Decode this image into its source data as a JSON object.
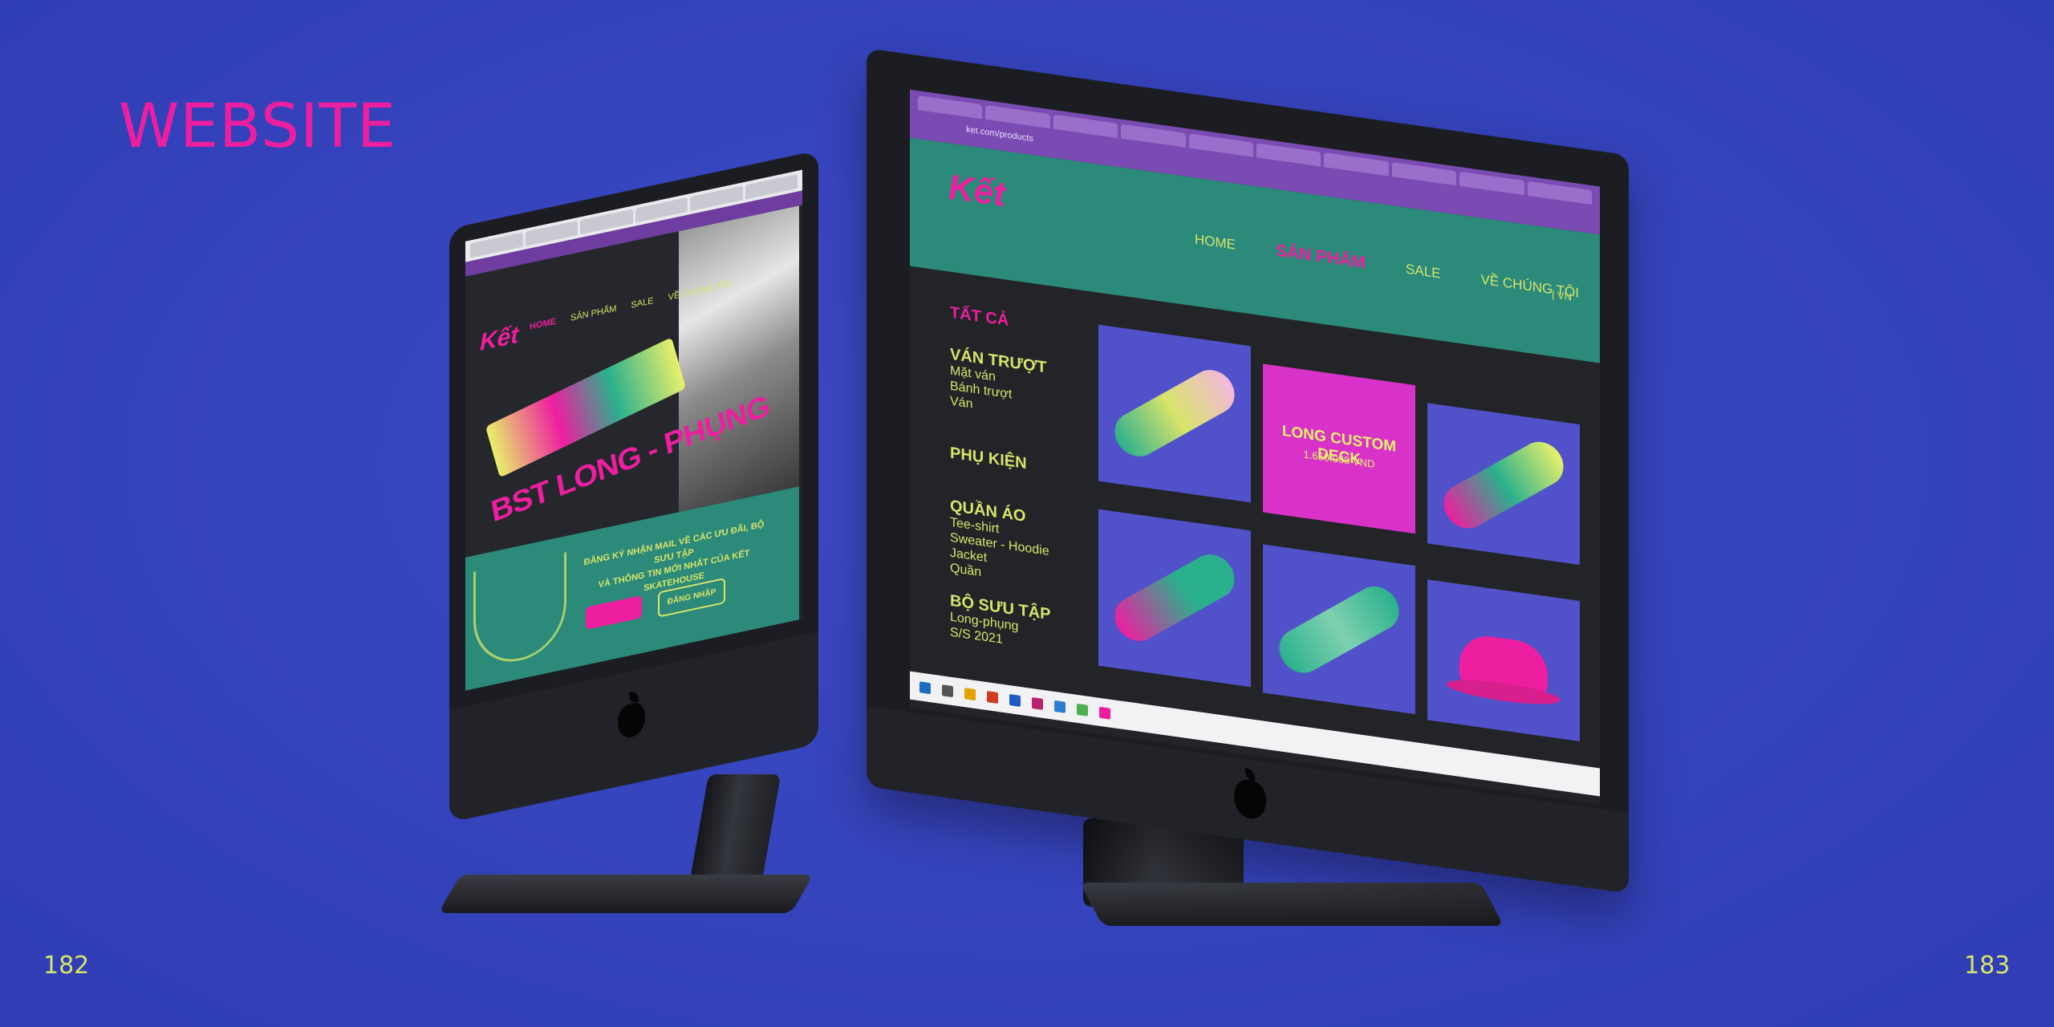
{
  "page": {
    "title": "WEBSITE",
    "page_left": "182",
    "page_right": "183"
  },
  "left_screen": {
    "nav": [
      "HOME",
      "SẢN PHẨM",
      "SALE",
      "VỀ CHÚNG TÔI"
    ],
    "headline": "BST LONG - PHỤNG",
    "cta_line1": "ĐĂNG KÝ NHẬN MAIL VỀ CÁC ƯU ĐÃI, BỘ SƯU TẬP",
    "cta_line2": "VÀ THÔNG TIN MỚI NHẤT CỦA KẾT SKATEHOUSE",
    "button_secondary": "ĐĂNG NHẬP"
  },
  "right_screen": {
    "url": "ket.com/products",
    "nav": {
      "home": "HOME",
      "products": "SẢN PHẨM",
      "sale": "SALE",
      "about": "VỀ CHÚNG TÔI",
      "lang": "| VN"
    },
    "sidebar": {
      "all": "TẤT CẢ",
      "skate": "VÁN TRƯỢT",
      "skate_items": [
        "Mặt ván",
        "Bánh trượt",
        "Ván"
      ],
      "accessories": "PHỤ KIỆN",
      "clothing": "QUẦN ÁO",
      "clothing_items": [
        "Tee-shirt",
        "Sweater - Hoodie",
        "Jacket",
        "Quần"
      ],
      "collection": "BỘ SƯU TẬP",
      "collection_items": [
        "Long-phụng",
        "S/S 2021"
      ]
    },
    "featured": {
      "title": "LONG CUSTOM DECK",
      "price": "1.650.000 VND"
    }
  },
  "colors": {
    "background": "#3543bc",
    "accent_pink": "#ee1ea0",
    "accent_lime": "#d8e46a",
    "teal": "#2c8a7a"
  }
}
